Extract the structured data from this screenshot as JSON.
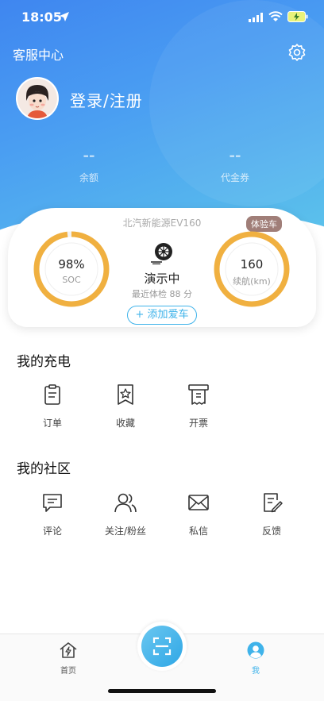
{
  "status": {
    "time": "18:05"
  },
  "header": {
    "service_center": "客服中心",
    "login": "登录/注册"
  },
  "stats": [
    {
      "value": "--",
      "label": "余额"
    },
    {
      "value": "--",
      "label": "代金券"
    }
  ],
  "car": {
    "model": "北汽新能源EV160",
    "badge": "体验车",
    "soc_value": "98%",
    "soc_label": "SOC",
    "soc_fraction": 0.98,
    "range_value": "160",
    "range_label": "续航(km)",
    "status": "演示中",
    "recent_check": "最近体检 88 分",
    "add_car": "+ 添加爱车"
  },
  "charging": {
    "title": "我的充电",
    "items": [
      {
        "label": "订单",
        "icon": "clipboard-icon"
      },
      {
        "label": "收藏",
        "icon": "star-bookmark-icon"
      },
      {
        "label": "开票",
        "icon": "receipt-icon"
      }
    ]
  },
  "community": {
    "title": "我的社区",
    "items": [
      {
        "label": "评论",
        "icon": "comment-icon"
      },
      {
        "label": "关注/粉丝",
        "icon": "people-icon"
      },
      {
        "label": "私信",
        "icon": "mail-icon"
      },
      {
        "label": "反馈",
        "icon": "feedback-icon"
      }
    ]
  },
  "tabbar": {
    "home": "首页",
    "me": "我"
  },
  "colors": {
    "accent": "#3fb3ea",
    "ring": "#f0b040",
    "header_start": "#3f86f0",
    "header_end": "#5ec7ea"
  }
}
